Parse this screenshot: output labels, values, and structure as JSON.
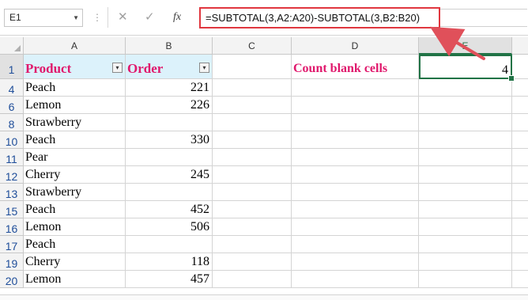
{
  "formula_bar": {
    "name_box": "E1",
    "fx_label": "fx",
    "formula": "=SUBTOTAL(3,A2:A20)-SUBTOTAL(3,B2:B20)"
  },
  "columns": [
    "A",
    "B",
    "C",
    "D",
    "E"
  ],
  "selected_column": "E",
  "rows": [
    {
      "num": "1",
      "a": "Product",
      "b": "Order",
      "d": "Count blank cells",
      "e": "4"
    },
    {
      "num": "4",
      "a": "Peach",
      "b": "221"
    },
    {
      "num": "6",
      "a": "Lemon",
      "b": "226"
    },
    {
      "num": "8",
      "a": "Strawberry",
      "b": ""
    },
    {
      "num": "10",
      "a": "Peach",
      "b": "330"
    },
    {
      "num": "11",
      "a": "Pear",
      "b": ""
    },
    {
      "num": "12",
      "a": "Cherry",
      "b": "245"
    },
    {
      "num": "13",
      "a": "Strawberry",
      "b": ""
    },
    {
      "num": "15",
      "a": "Peach",
      "b": "452"
    },
    {
      "num": "16",
      "a": "Lemon",
      "b": "506"
    },
    {
      "num": "17",
      "a": "Peach",
      "b": ""
    },
    {
      "num": "19",
      "a": "Cherry",
      "b": "118"
    },
    {
      "num": "20",
      "a": "Lemon",
      "b": "457"
    }
  ],
  "active_cell": "E1",
  "colors": {
    "header_fill": "#dcf2fb",
    "header_text": "#e0186c",
    "highlight_border": "#e0373f",
    "arrow": "#e0505a",
    "selection": "#217346"
  },
  "icons": {
    "namebox_dropdown": "chevron-down-icon",
    "cancel": "close-icon",
    "enter": "check-icon",
    "function": "fx-icon",
    "filter_product": "filter-active-icon",
    "filter_order": "dropdown-arrow-icon"
  }
}
